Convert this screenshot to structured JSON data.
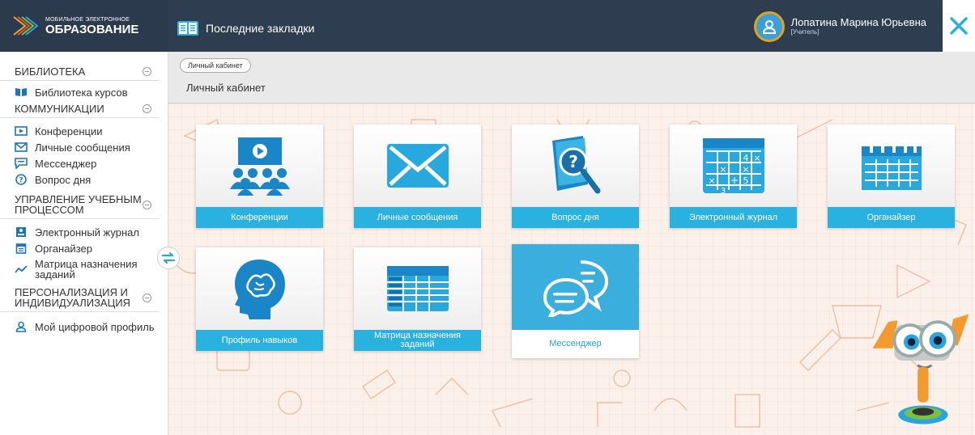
{
  "header": {
    "logo_small": "МОБИЛЬНОЕ ЭЛЕКТРОННОЕ",
    "logo_big": "ОБРАЗОВАНИЕ",
    "bookmarks_label": "Последние закладки",
    "user_name": "Лопатина Марина Юрьевна",
    "user_role": "[Учитель]",
    "close_icon": "close-icon"
  },
  "sidebar": {
    "library_title": "БИБЛИОТЕКА",
    "library_items": [
      {
        "label": "Библиотека курсов",
        "icon": "book-icon"
      }
    ],
    "comm_title": "КОММУНИКАЦИИ",
    "comm_items": [
      {
        "label": "Конференции",
        "icon": "video-icon"
      },
      {
        "label": "Личные сообщения",
        "icon": "mail-icon"
      },
      {
        "label": "Мессенджер",
        "icon": "chat-icon"
      },
      {
        "label": "Вопрос дня",
        "icon": "question-icon"
      }
    ],
    "study_title": "УПРАВЛЕНИЕ УЧЕБНЫМ ПРОЦЕССОМ",
    "study_items": [
      {
        "label": "Электронный журнал",
        "icon": "journal-icon"
      },
      {
        "label": "Органайзер",
        "icon": "calendar-icon"
      },
      {
        "label": "Матрица назначения заданий",
        "icon": "chart-line-icon"
      }
    ],
    "person_title": "ПЕРСОНАЛИЗАЦИЯ И ИНДИВИДУАЛИЗАЦИЯ",
    "person_items": [
      {
        "label": "Мой цифровой профиль",
        "icon": "user-icon"
      }
    ]
  },
  "main": {
    "breadcrumb": "Личный кабинет",
    "page_title": "Личный кабинет",
    "tiles": [
      {
        "label": "Конференции",
        "icon": "conference-icon"
      },
      {
        "label": "Личные сообщения",
        "icon": "envelope-icon"
      },
      {
        "label": "Вопрос дня",
        "icon": "question-book-icon"
      },
      {
        "label": "Электронный журнал",
        "icon": "journal-grid-icon"
      },
      {
        "label": "Органайзер",
        "icon": "organizer-calendar-icon"
      },
      {
        "label": "Профиль навыков",
        "icon": "brain-head-icon"
      },
      {
        "label": "Матрица назначения заданий",
        "icon": "matrix-table-icon"
      },
      {
        "label": "Мессенджер",
        "icon": "speech-bubbles-icon"
      }
    ]
  },
  "colors": {
    "header_bg": "#2e3e50",
    "accent": "#29b1e0",
    "avatar_ring": "#e3a21a",
    "content_bg": "#fbf1ea"
  }
}
